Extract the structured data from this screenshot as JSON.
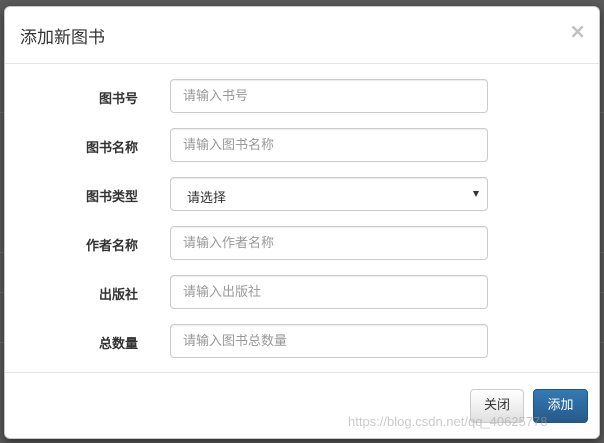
{
  "modal": {
    "title": "添加新图书",
    "close_symbol": "×"
  },
  "form": {
    "book_no": {
      "label": "图书号",
      "placeholder": "请输入书号"
    },
    "book_name": {
      "label": "图书名称",
      "placeholder": "请输入图书名称"
    },
    "book_type": {
      "label": "图书类型",
      "selected": "请选择"
    },
    "author": {
      "label": "作者名称",
      "placeholder": "请输入作者名称"
    },
    "publisher": {
      "label": "出版社",
      "placeholder": "请输入出版社"
    },
    "quantity": {
      "label": "总数量",
      "placeholder": "请输入图书总数量"
    }
  },
  "footer": {
    "close_label": "关闭",
    "add_label": "添加"
  },
  "watermark": "https://blog.csdn.net/qq_40625778",
  "colors": {
    "primary": "#337ab7",
    "overlay": "#5a5a5a"
  }
}
